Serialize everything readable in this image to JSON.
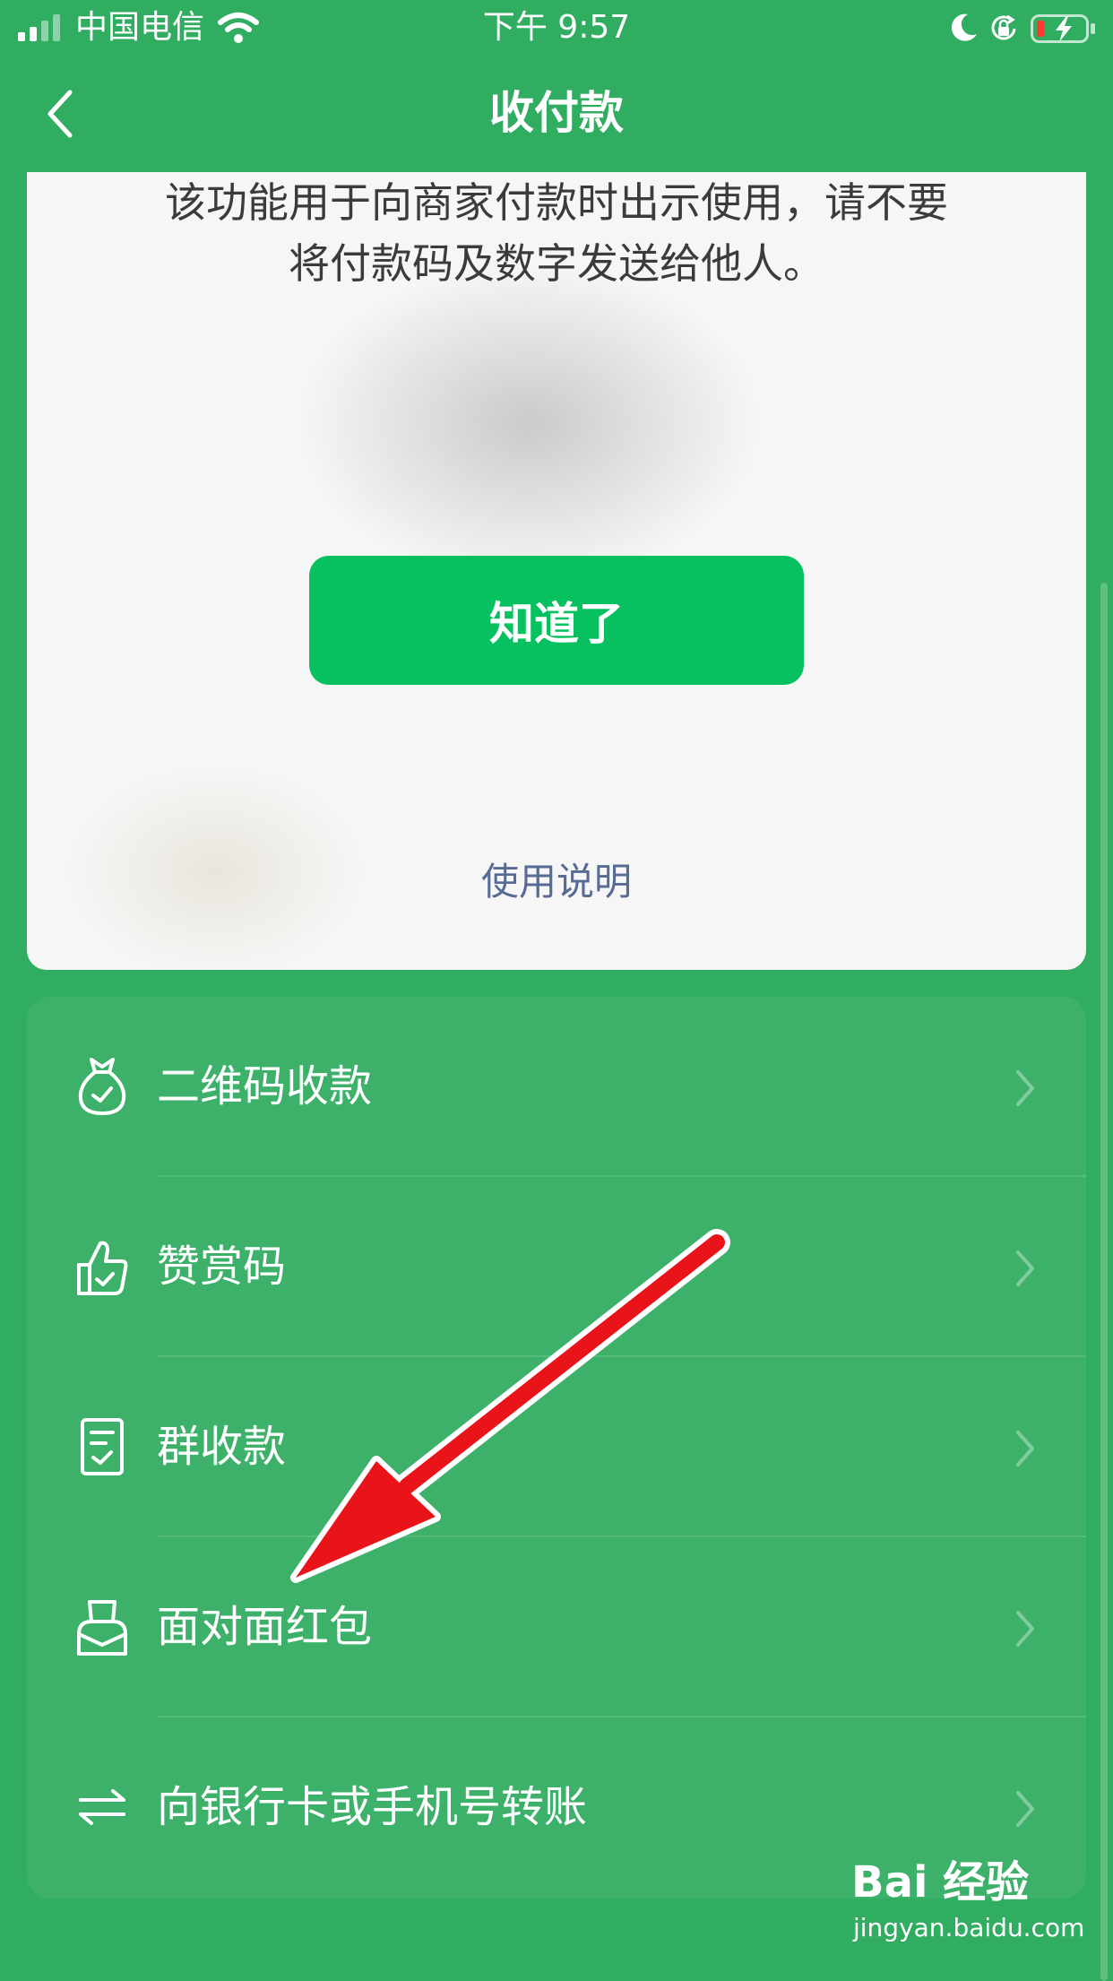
{
  "status_bar": {
    "carrier": "中国电信",
    "time": "下午 9:57"
  },
  "nav": {
    "title": "收付款"
  },
  "pay_card": {
    "notice_line1": "该功能用于向商家付款时出示使用，请不要",
    "notice_line2": "将付款码及数字发送给他人。",
    "confirm_label": "知道了",
    "usage_link": "使用说明"
  },
  "menu": {
    "items": [
      {
        "label": "二维码收款",
        "icon": "money-bag-icon"
      },
      {
        "label": "赞赏码",
        "icon": "thumbs-up-icon"
      },
      {
        "label": "群收款",
        "icon": "group-receipt-icon"
      },
      {
        "label": "面对面红包",
        "icon": "red-envelope-icon"
      },
      {
        "label": "向银行卡或手机号转账",
        "icon": "transfer-arrows-icon"
      }
    ]
  },
  "watermark": {
    "logo_text": "Bai 经验",
    "url": "jingyan.baidu.com"
  },
  "colors": {
    "background": "#31ad61",
    "primary_button": "#07c160",
    "link": "#576b95",
    "annotation_arrow": "#e8141a"
  }
}
